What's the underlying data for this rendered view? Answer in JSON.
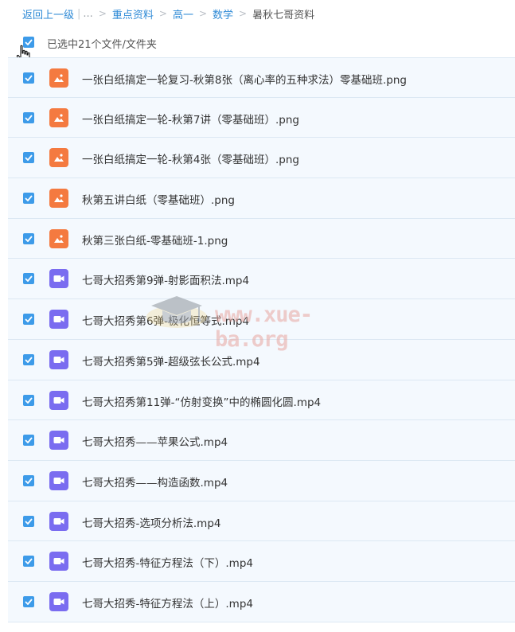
{
  "breadcrumb": {
    "back": "返回上一级",
    "ellipsis": "...",
    "separator": ">",
    "items": [
      "重点资料",
      "高一",
      "数学"
    ],
    "current": "暑秋七哥资料"
  },
  "selection": {
    "summary": "已选中21个文件/文件夹"
  },
  "files": [
    {
      "name": "一张白纸搞定一轮复习-秋第8张（离心率的五种求法）零基础班.png",
      "type": "png",
      "icon": "image-file-icon",
      "checked": true
    },
    {
      "name": "一张白纸搞定一轮-秋第7讲（零基础班）.png",
      "type": "png",
      "icon": "image-file-icon",
      "checked": true
    },
    {
      "name": "一张白纸搞定一轮-秋第4张（零基础班）.png",
      "type": "png",
      "icon": "image-file-icon",
      "checked": true
    },
    {
      "name": "秋第五讲白纸（零基础班）.png",
      "type": "png",
      "icon": "image-file-icon",
      "checked": true
    },
    {
      "name": "秋第三张白纸-零基础班-1.png",
      "type": "png",
      "icon": "image-file-icon",
      "checked": true
    },
    {
      "name": "七哥大招秀第9弹-射影面积法.mp4",
      "type": "mp4",
      "icon": "video-file-icon",
      "checked": true
    },
    {
      "name": "七哥大招秀第6弹-极化恒等式.mp4",
      "type": "mp4",
      "icon": "video-file-icon",
      "checked": true
    },
    {
      "name": "七哥大招秀第5弹-超级弦长公式.mp4",
      "type": "mp4",
      "icon": "video-file-icon",
      "checked": true
    },
    {
      "name": "七哥大招秀第11弹-“仿射变换”中的椭圆化圆.mp4",
      "type": "mp4",
      "icon": "video-file-icon",
      "checked": true
    },
    {
      "name": "七哥大招秀——苹果公式.mp4",
      "type": "mp4",
      "icon": "video-file-icon",
      "checked": true
    },
    {
      "name": "七哥大招秀——构造函数.mp4",
      "type": "mp4",
      "icon": "video-file-icon",
      "checked": true
    },
    {
      "name": "七哥大招秀-选项分析法.mp4",
      "type": "mp4",
      "icon": "video-file-icon",
      "checked": true
    },
    {
      "name": "七哥大招秀-特征方程法（下）.mp4",
      "type": "mp4",
      "icon": "video-file-icon",
      "checked": true
    },
    {
      "name": "七哥大招秀-特征方程法（上）.mp4",
      "type": "mp4",
      "icon": "video-file-icon",
      "checked": true
    }
  ],
  "watermark": {
    "text": "www.xue-ba.org"
  },
  "colors": {
    "accent": "#3d9be9",
    "link": "#2e8ad6",
    "image_icon": "#f47a40",
    "video_icon": "#7a6cf0",
    "row_background": "#f4f9fe"
  }
}
